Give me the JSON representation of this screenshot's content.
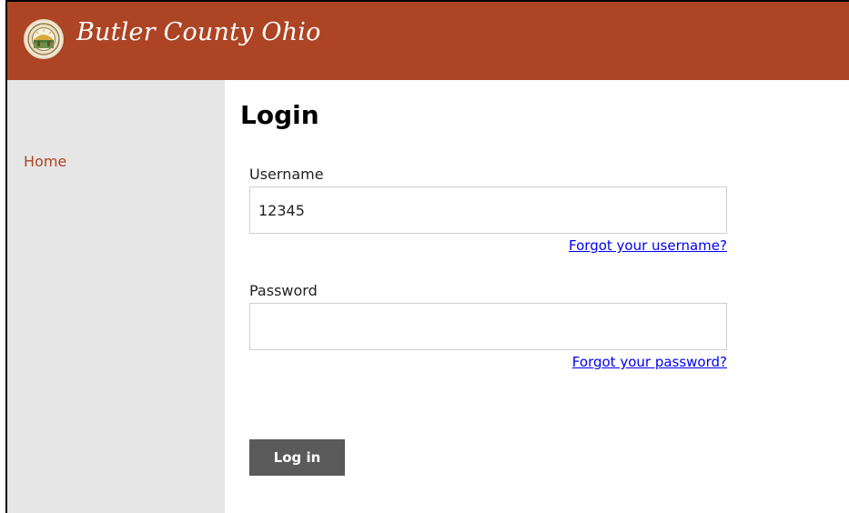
{
  "header": {
    "title": "Butler County Ohio",
    "seal_icon": "county-seal-icon",
    "background_color": "#ad4424"
  },
  "sidebar": {
    "items": [
      {
        "label": "Home"
      }
    ],
    "link_color": "#ad4424"
  },
  "main": {
    "title": "Login",
    "username": {
      "label": "Username",
      "value": "12345",
      "forgot_link": "Forgot your username?"
    },
    "password": {
      "label": "Password",
      "value": "",
      "forgot_link": "Forgot your password?"
    },
    "submit_label": "Log in",
    "button_color": "#5a5a5a"
  }
}
